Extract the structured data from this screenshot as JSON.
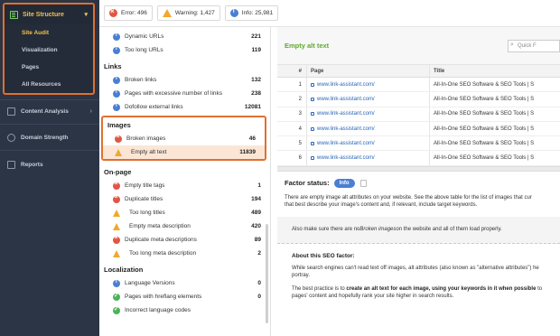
{
  "sidebar": {
    "group_title": "Site Structure",
    "sub_items": [
      "Site Audit",
      "Visualization",
      "Pages",
      "All Resources"
    ],
    "items": [
      {
        "label": "Content Analysis"
      },
      {
        "label": "Domain Strength"
      },
      {
        "label": "Reports"
      }
    ]
  },
  "status": {
    "error": "Error: 496",
    "warning": "Warning: 1,427",
    "info": "Info: 25,981"
  },
  "issues": {
    "top_rows": [
      {
        "label": "Dynamic URLs",
        "count": "221",
        "status": "info"
      },
      {
        "label": "Too long URLs",
        "count": "119",
        "status": "info"
      }
    ],
    "links_title": "Links",
    "links": [
      {
        "label": "Broken links",
        "count": "132",
        "status": "info"
      },
      {
        "label": "Pages with excessive number of links",
        "count": "238",
        "status": "info"
      },
      {
        "label": "Dofollow external links",
        "count": "12081",
        "status": "info"
      }
    ],
    "images_title": "Images",
    "images": [
      {
        "label": "Broken images",
        "count": "46",
        "status": "err"
      },
      {
        "label": "Empty alt text",
        "count": "11839",
        "status": "warn"
      }
    ],
    "onpage_title": "On-page",
    "onpage": [
      {
        "label": "Empty title tags",
        "count": "1",
        "status": "err"
      },
      {
        "label": "Duplicate titles",
        "count": "194",
        "status": "err"
      },
      {
        "label": "Too long titles",
        "count": "489",
        "status": "warn"
      },
      {
        "label": "Empty meta description",
        "count": "420",
        "status": "warn"
      },
      {
        "label": "Duplicate meta descriptions",
        "count": "89",
        "status": "err"
      },
      {
        "label": "Too long meta description",
        "count": "2",
        "status": "warn"
      }
    ],
    "localization_title": "Localization",
    "localization": [
      {
        "label": "Language Versions",
        "count": "0",
        "status": "info"
      },
      {
        "label": "Pages with hreflang elements",
        "count": "0",
        "status": "ok"
      },
      {
        "label": "Incorrect language codes",
        "count": "",
        "status": "ok"
      }
    ]
  },
  "detail": {
    "title": "Empty alt text",
    "filter_placeholder": "Quick F",
    "columns": [
      "#",
      "Page",
      "Title"
    ],
    "rows": [
      {
        "n": "1",
        "page": "www.link-assistant.com/",
        "title": "All-In-One SEO Software & SEO Tools | S"
      },
      {
        "n": "2",
        "page": "www.link-assistant.com/",
        "title": "All-In-One SEO Software & SEO Tools | S"
      },
      {
        "n": "3",
        "page": "www.link-assistant.com/",
        "title": "All-In-One SEO Software & SEO Tools | S"
      },
      {
        "n": "4",
        "page": "www.link-assistant.com/",
        "title": "All-In-One SEO Software & SEO Tools | S"
      },
      {
        "n": "5",
        "page": "www.link-assistant.com/",
        "title": "All-In-One SEO Software & SEO Tools | S"
      },
      {
        "n": "6",
        "page": "www.link-assistant.com/",
        "title": "All-In-One SEO Software & SEO Tools | S"
      }
    ],
    "factor_label": "Factor status:",
    "factor_badge": "Info",
    "desc_line1": "There are empty image alt attributes on your website. See the above table for the list of images that cur",
    "desc_line2": "that best describe your image's content and, if relevant, include target keywords.",
    "note_pre": "Also make sure there are no ",
    "note_em": "Broken images",
    "note_post": " on the website and all of them load properly.",
    "about_title": "About this SEO factor:",
    "about_p1a": "While search engines can't read text off images, alt attributes (also known as \"alternative attributes\") he",
    "about_p1b": "portray.",
    "about_p2a_pre": "The best practice is to ",
    "about_p2a_bold": "create an alt text for each image, using your keywords in it when possible",
    "about_p2a_post": " to",
    "about_p2b": "pages' content and hopefully rank your site higher in search results."
  }
}
